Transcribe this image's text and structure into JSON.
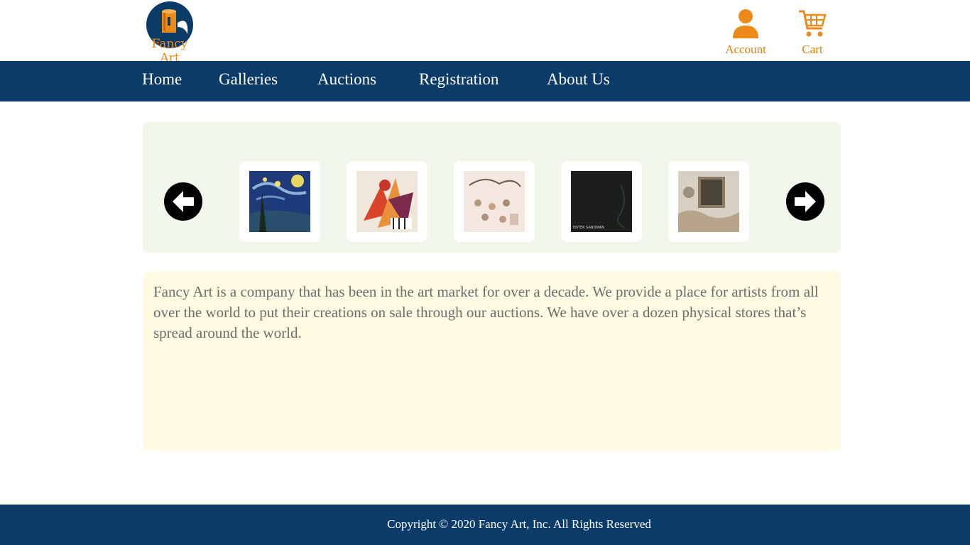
{
  "brand": {
    "name": "Fancy Art",
    "primary_color": "#0b3b68",
    "accent_color": "#e67e0a"
  },
  "header": {
    "account_label": "Account",
    "cart_label": "Cart",
    "account_icon": "user-icon",
    "cart_icon": "shopping-cart-icon"
  },
  "nav": {
    "items": [
      {
        "label": "Home"
      },
      {
        "label": "Galleries"
      },
      {
        "label": "Auctions"
      },
      {
        "label": "Registration"
      },
      {
        "label": "About Us"
      }
    ]
  },
  "carousel": {
    "prev_icon": "arrow-left-circle-icon",
    "next_icon": "arrow-right-circle-icon",
    "thumbnails": [
      {
        "name": "starry-night"
      },
      {
        "name": "abstract-colorful"
      },
      {
        "name": "led-zeppelin-ii"
      },
      {
        "name": "enter-sandman",
        "caption": "ENTER SANDMAN"
      },
      {
        "name": "led-zeppelin-iv"
      }
    ]
  },
  "about": {
    "text": "Fancy Art is a company that has been in the art market for over a decade. We provide a place for artists from all over the world  to put their creations on sale through our auctions.  We have over a dozen physical stores that’s spread around the world."
  },
  "footer": {
    "copyright": "Copyright © 2020 Fancy Art, Inc. All Rights Reserved"
  }
}
